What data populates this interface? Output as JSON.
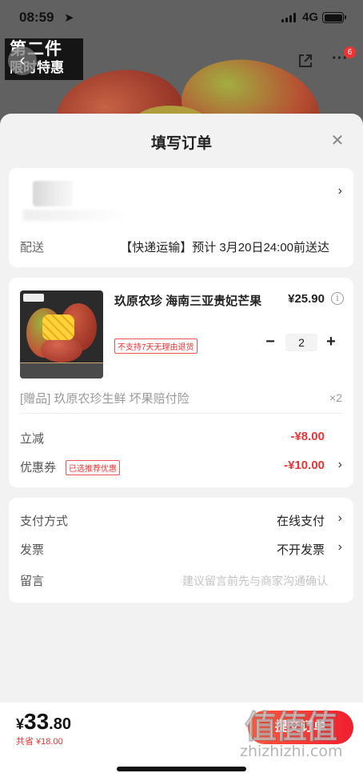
{
  "status_bar": {
    "time": "08:59",
    "network": "4G"
  },
  "product_page": {
    "promo_line1": "第二件",
    "promo_line2": "限时特惠",
    "more_badge": "6"
  },
  "sheet": {
    "title": "填写订单",
    "close_icon": "close-icon"
  },
  "address": {
    "ship_label": "配送",
    "ship_value": "【快递运输】预计 3月20日24:00前送达"
  },
  "product": {
    "name": "玖原农珍 海南三亚贵妃芒果",
    "price": "¥25.90",
    "no_return_tag": "不支持7天无理由退货",
    "quantity": "2",
    "gift": "[赠品] 玖原农珍生鲜 坏果赔付险",
    "gift_qty": "×2",
    "discount_label": "立减",
    "discount_value": "-¥8.00",
    "coupon_label": "优惠券",
    "coupon_tag": "已选推荐优惠",
    "coupon_value": "-¥10.00"
  },
  "payment": {
    "pay_label": "支付方式",
    "pay_value": "在线支付",
    "invoice_label": "发票",
    "invoice_value": "不开发票",
    "remark_label": "留言",
    "remark_placeholder": "建议留言前先与商家沟通确认"
  },
  "bottom": {
    "currency": "¥",
    "total_int": "33",
    "total_dec": ".80",
    "saved": "共省 ¥18.00",
    "submit": "提交订单"
  },
  "watermark": {
    "mark": "值值值",
    "url": "zhizhizhi.com"
  },
  "colors": {
    "accent_red": "#ee1f2f",
    "price_red": "#e33333"
  }
}
